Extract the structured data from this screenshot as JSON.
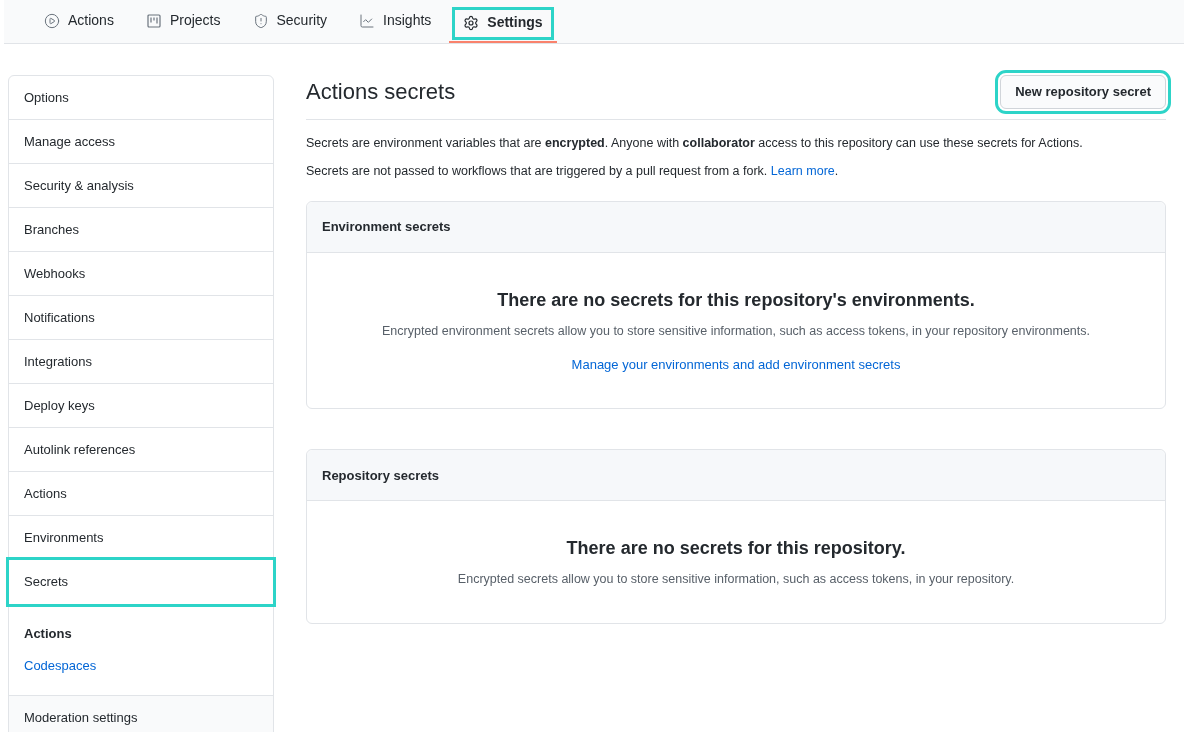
{
  "tabs": [
    {
      "label": "Actions",
      "kind": "play",
      "selected": false,
      "highlighted": false
    },
    {
      "label": "Projects",
      "kind": "board",
      "selected": false,
      "highlighted": false
    },
    {
      "label": "Security",
      "kind": "shield",
      "selected": false,
      "highlighted": false
    },
    {
      "label": "Insights",
      "kind": "graph",
      "selected": false,
      "highlighted": false
    },
    {
      "label": "Settings",
      "kind": "gear",
      "selected": true,
      "highlighted": true
    }
  ],
  "sidebar": {
    "items": [
      {
        "kind": "item",
        "label": "Options",
        "highlighted": false
      },
      {
        "kind": "item",
        "label": "Manage access",
        "highlighted": false
      },
      {
        "kind": "item",
        "label": "Security & analysis",
        "highlighted": false
      },
      {
        "kind": "item",
        "label": "Branches",
        "highlighted": false
      },
      {
        "kind": "item",
        "label": "Webhooks",
        "highlighted": false
      },
      {
        "kind": "item",
        "label": "Notifications",
        "highlighted": false
      },
      {
        "kind": "item",
        "label": "Integrations",
        "highlighted": false
      },
      {
        "kind": "item",
        "label": "Deploy keys",
        "highlighted": false
      },
      {
        "kind": "item",
        "label": "Autolink references",
        "highlighted": false
      },
      {
        "kind": "item",
        "label": "Actions",
        "highlighted": false
      },
      {
        "kind": "item",
        "label": "Environments",
        "highlighted": false
      },
      {
        "kind": "item",
        "label": "Secrets",
        "highlighted": true
      },
      {
        "kind": "group",
        "label": "Actions",
        "links": [
          "Codespaces"
        ]
      },
      {
        "kind": "muted",
        "label": "Moderation settings",
        "highlighted": false
      }
    ]
  },
  "main": {
    "title": "Actions secrets",
    "new_button": {
      "label": "New repository secret",
      "highlighted": true
    },
    "intro": "Secrets are environment variables that are **encrypted**. Anyone with **collaborator** access to this repository can use these secrets for Actions.",
    "note": {
      "text": "Secrets are not passed to workflows that are triggered by a pull request from a fork.",
      "link": "Learn more",
      "after": "."
    },
    "sections": [
      {
        "header": "Environment secrets",
        "heading": "There are no secrets for this repository's environments.",
        "body": "Encrypted environment secrets allow you to store sensitive information, such as access tokens, in your repository environments.",
        "link": "Manage your environments and add environment secrets"
      },
      {
        "header": "Repository secrets",
        "heading": "There are no secrets for this repository.",
        "body": "Encrypted secrets allow you to store sensitive information, such as access tokens, in your repository."
      }
    ]
  }
}
